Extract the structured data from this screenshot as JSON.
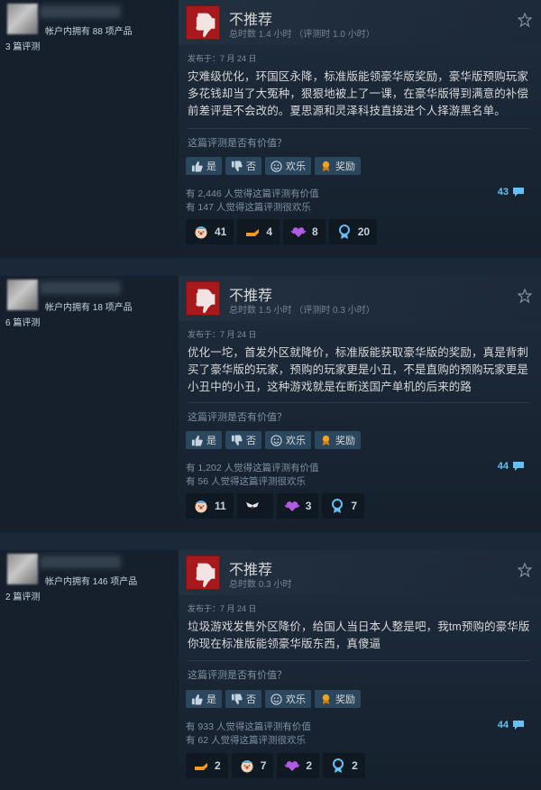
{
  "colors": {
    "background": "#1b2838",
    "panel": "#16202d",
    "not_recommended_red": "#a8191c",
    "link_blue": "#66c0f4",
    "button_bg": "#2a475e"
  },
  "labels": {
    "not_recommended": "不推荐",
    "helpful_question": "这篇评测是否有价值？",
    "btn_yes": "是",
    "btn_no": "否",
    "btn_funny": "欢乐",
    "btn_award": "奖励"
  },
  "reviews": [
    {
      "products": "帐户内拥有 88 项产品",
      "review_count": "3 篇评测",
      "title": "不推荐",
      "hours": "总时数 1.4 小时   （评测时 1.0 小时）",
      "posted": "发布于：7 月 24 日",
      "text": "灾难级优化，环国区永降，标准版能领豪华版奖励，豪华版预购玩家多花钱却当了大冤种，狠狠地被上了一课，在豪华版得到满意的补偿前差评是不会改的。夏思源和灵泽科技直接进个人择游黑名单。",
      "helpful_count": "有 2,446 人觉得这篇评测有价值",
      "funny_count": "有 147 人觉得这篇评测很欢乐",
      "comments": "43",
      "awards": [
        {
          "icon": "clown-face-icon",
          "value": "41"
        },
        {
          "icon": "hot-take-icon",
          "value": "4"
        },
        {
          "icon": "heart-icon",
          "value": "8"
        },
        {
          "icon": "medal-icon",
          "value": "20"
        }
      ]
    },
    {
      "products": "帐户内拥有 18 项产品",
      "review_count": "6 篇评测",
      "title": "不推荐",
      "hours": "总时数 1.5 小时   （评测时 0.3 小时）",
      "posted": "发布于：7 月 24 日",
      "text": "优化一坨，首发外区就降价，标准版能获取豪华版的奖励，真是背刺买了豪华版的玩家，预购的玩家更是小丑，不是直购的预购玩家更是小丑中的小丑，这种游戏就是在断送国产单机的后来的路",
      "helpful_count": "有 1,202 人觉得这篇评测有价值",
      "funny_count": "有 56 人觉得这篇评测很欢乐",
      "comments": "44",
      "awards": [
        {
          "icon": "clown-face-icon",
          "value": "11"
        },
        {
          "icon": "winged-icon",
          "value": ""
        },
        {
          "icon": "heart-icon",
          "value": "3"
        },
        {
          "icon": "medal-icon",
          "value": "7"
        }
      ]
    },
    {
      "products": "帐户内拥有 146 项产品",
      "review_count": "2 篇评测",
      "title": "不推荐",
      "hours": "总时数 0.3 小时",
      "posted": "发布于：7 月 24 日",
      "text": "垃圾游戏发售外区降价，给国人当日本人整是吧，我tm预购的豪华版你现在标准版能领豪华版东西，真傻逼",
      "helpful_count": "有 933 人觉得这篇评测有价值",
      "funny_count": "有 62 人觉得这篇评测很欢乐",
      "comments": "44",
      "awards": [
        {
          "icon": "hot-take-icon",
          "value": "2"
        },
        {
          "icon": "clown-face-icon",
          "value": "7"
        },
        {
          "icon": "heart-icon",
          "value": "2"
        },
        {
          "icon": "medal-icon",
          "value": "2"
        }
      ]
    }
  ]
}
